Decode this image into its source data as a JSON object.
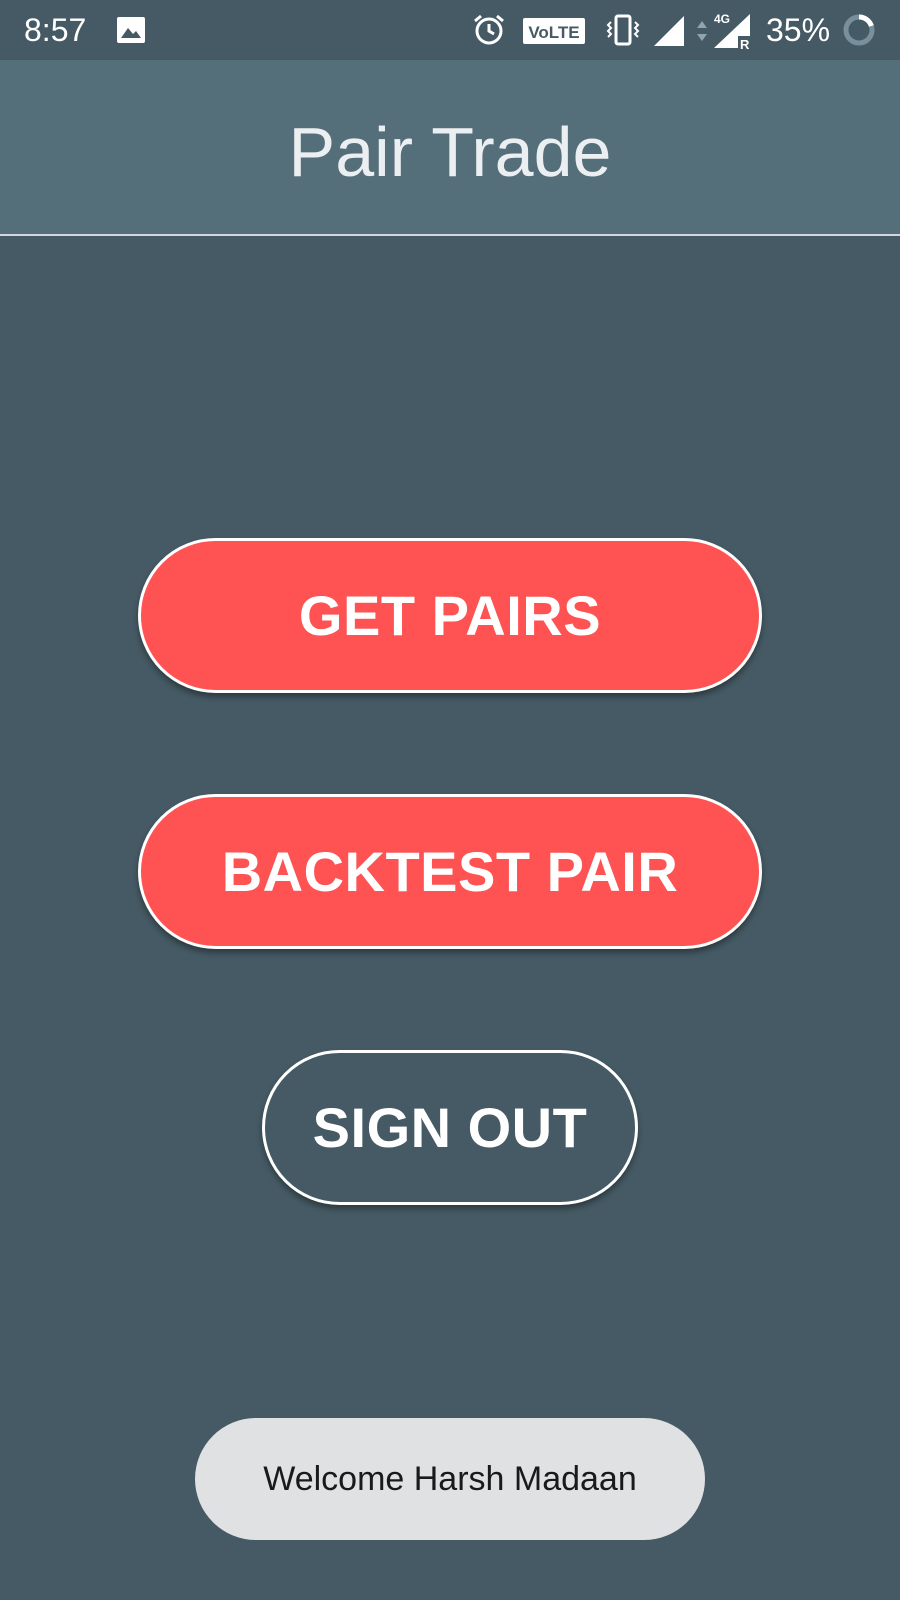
{
  "status_bar": {
    "time": "8:57",
    "battery_percent": "35%",
    "volte_label": "VoLTE",
    "network_label": "4G",
    "roaming_label": "R",
    "icons": [
      "image-icon",
      "alarm-icon",
      "volte-icon",
      "vibrate-icon",
      "signal-icon",
      "data-arrows-icon",
      "signal-4g-icon",
      "battery-icon"
    ]
  },
  "app_bar": {
    "title": "Pair Trade",
    "background": "#546E7A"
  },
  "actions": {
    "get_pairs": "GET PAIRS",
    "backtest_pair": "BACKTEST PAIR",
    "sign_out": "SIGN OUT"
  },
  "toast": {
    "message": "Welcome Harsh Madaan"
  },
  "colors": {
    "background": "#455A64",
    "accent": "#FF5252",
    "toast_bg": "#E0E1E3"
  }
}
